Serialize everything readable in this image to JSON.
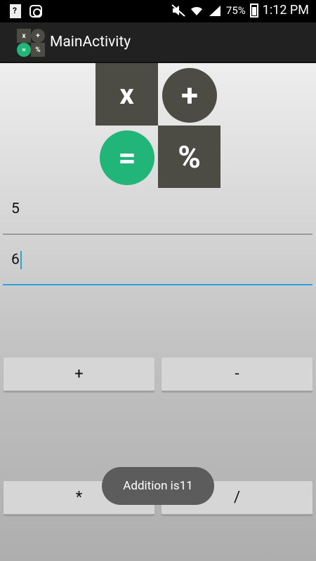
{
  "statusbar": {
    "battery": "75%",
    "time": "1:12 PM"
  },
  "actionbar": {
    "title": "MainActivity",
    "logo_symbols": [
      "x",
      "+",
      "=",
      "%"
    ]
  },
  "logo": {
    "times": "x",
    "plus": "+",
    "equals": "=",
    "percent": "%",
    "dark_color": "#4c4b44",
    "green_color": "#22b57a"
  },
  "form": {
    "first_value": "5",
    "second_value": "6"
  },
  "buttons": {
    "add": "+",
    "subtract": "-",
    "multiply": "*",
    "divide": "/"
  },
  "toast": {
    "message": "Addition is11"
  }
}
